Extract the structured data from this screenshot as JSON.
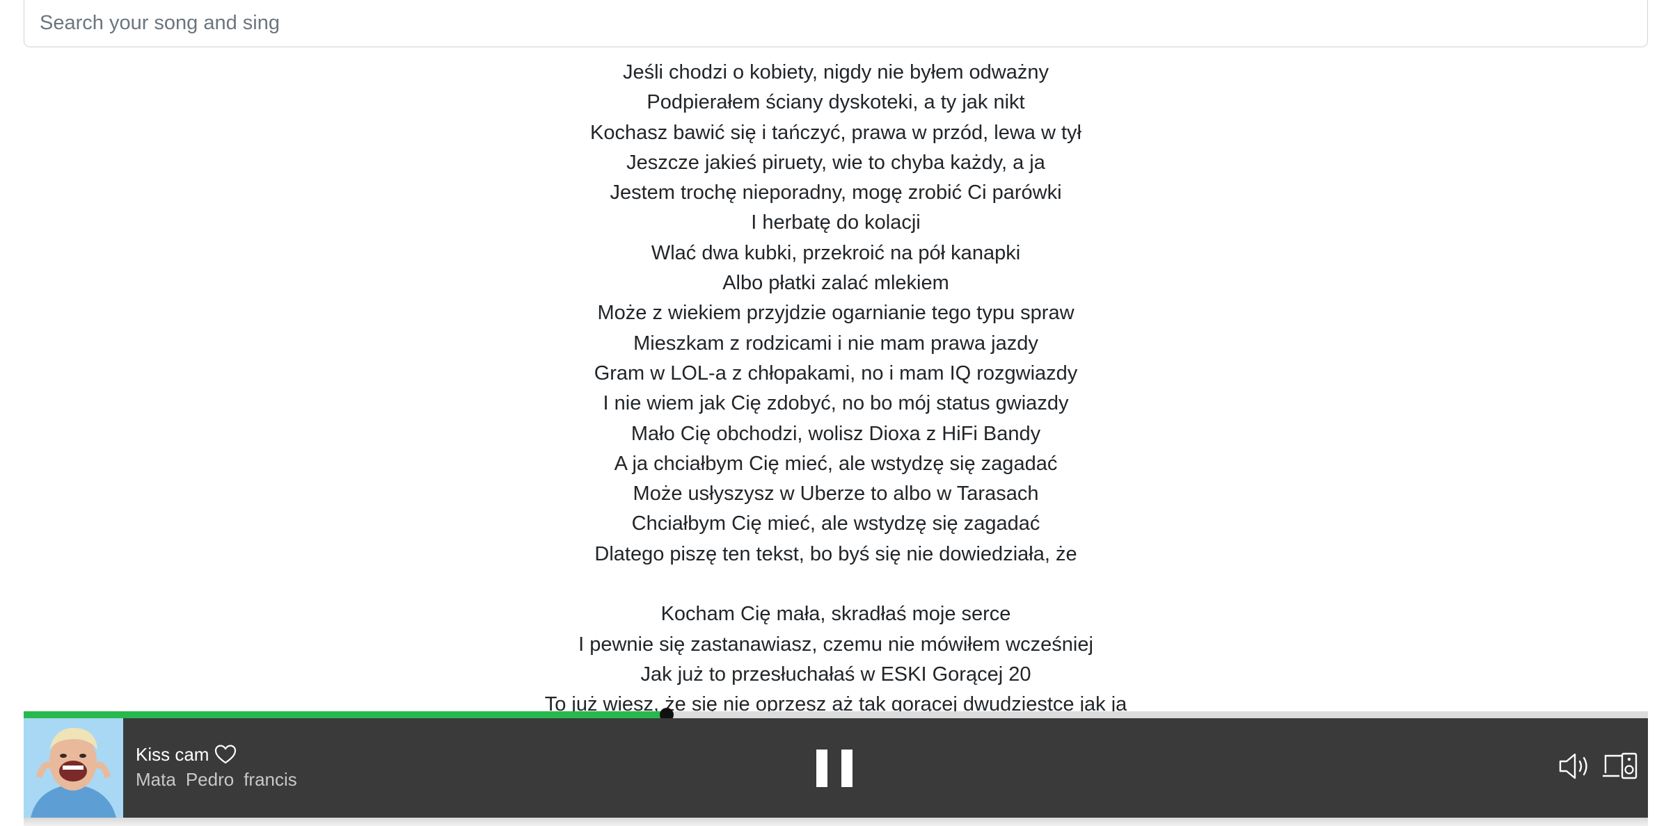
{
  "search": {
    "placeholder": "Search your song and sing"
  },
  "lyrics": [
    "Jeśli chodzi o kobiety, nigdy nie byłem odważny",
    "Podpierałem ściany dyskoteki, a ty jak nikt",
    "Kochasz bawić się i tańczyć, prawa w przód, lewa w tył",
    "Jeszcze jakieś piruety, wie to chyba każdy, a ja",
    "Jestem trochę nieporadny, mogę zrobić Ci parówki",
    "I herbatę do kolacji",
    "Wlać dwa kubki, przekroić na pół kanapki",
    "Albo płatki zalać mlekiem",
    "Może z wiekiem przyjdzie ogarnianie tego typu spraw",
    "Mieszkam z rodzicami i nie mam prawa jazdy",
    "Gram w LOL-a z chłopakami, no i mam IQ rozgwiazdy",
    "I nie wiem jak Cię zdobyć, no bo mój status gwiazdy",
    "Mało Cię obchodzi, wolisz Dioxa z HiFi Bandy",
    "A ja chciałbym Cię mieć, ale wstydzę się zagadać",
    "Może usłyszysz w Uberze to albo w Tarasach",
    "Chciałbym Cię mieć, ale wstydzę się zagadać",
    "Dlatego piszę ten tekst, bo byś się nie dowiedziała, że",
    "",
    "Kocham Cię mała, skradłaś moje serce",
    "I pewnie się zastanawiasz, czemu nie mówiłem wcześniej",
    "Jak już to przesłuchałaś w ESKI Gorącej 20",
    "To już wiesz, że się nie oprzesz aż tak gorącej dwudziestce jak ja"
  ],
  "player": {
    "progress": 0.396,
    "track_title": "Kiss cam",
    "artists": [
      "Mata",
      "Pedro",
      "francis"
    ],
    "icons": {
      "like": "heart-outline-icon",
      "play_state": "pause-icon",
      "volume": "volume-icon",
      "devices": "devices-icon"
    },
    "colors": {
      "progress_fill": "#28b84e",
      "bar_background": "#3a3a3a"
    }
  }
}
